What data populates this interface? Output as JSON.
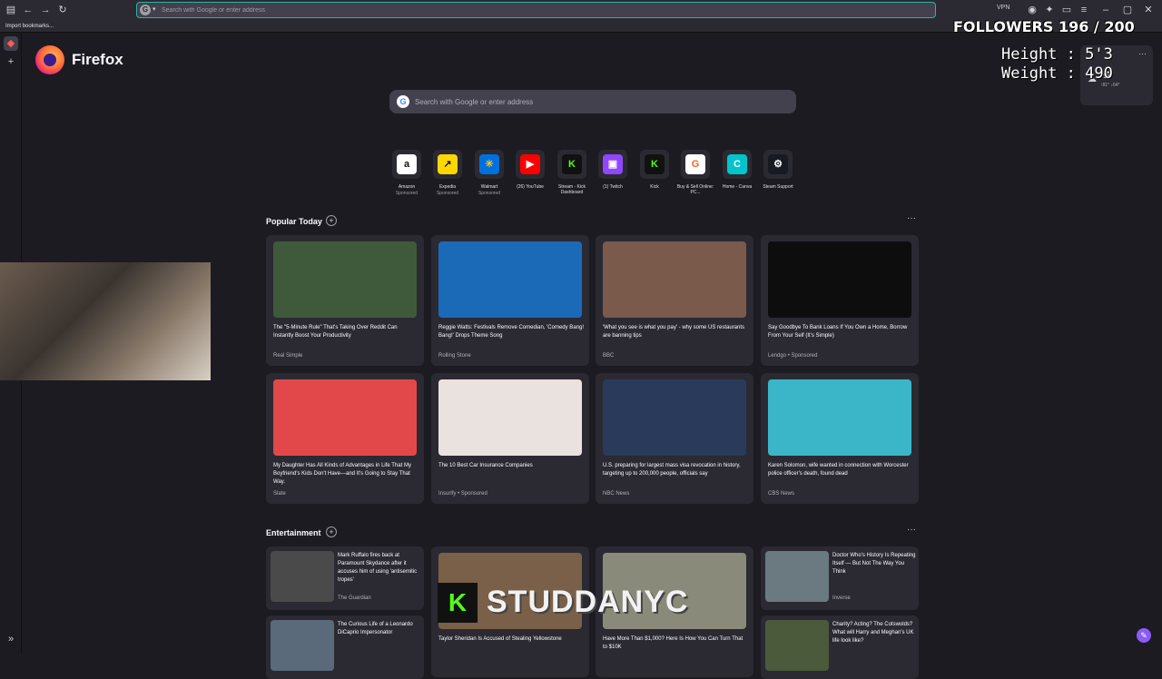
{
  "browser": {
    "url_placeholder": "Search with Google or enter address",
    "vpn_label": "VPN",
    "bookmark_item": "Import bookmarks..."
  },
  "brand": {
    "name": "Firefox"
  },
  "search": {
    "placeholder": "Search with Google or enter address"
  },
  "shortcuts": [
    {
      "label": "Amazon",
      "sponsored": "Sponsored",
      "glyph": "a",
      "bg": "#ffffff",
      "fg": "#111111"
    },
    {
      "label": "Expedia",
      "sponsored": "Sponsored",
      "glyph": "↗",
      "bg": "#ffd700",
      "fg": "#111111"
    },
    {
      "label": "Walmart",
      "sponsored": "Sponsored",
      "glyph": "✳",
      "bg": "#0071dc",
      "fg": "#ffc220"
    },
    {
      "label": "(26) YouTube",
      "sponsored": "",
      "glyph": "▶",
      "bg": "#ff0000",
      "fg": "#ffffff"
    },
    {
      "label": "Stream - Kick Dashboard",
      "sponsored": "",
      "glyph": "K",
      "bg": "#111111",
      "fg": "#53fc18"
    },
    {
      "label": "(1) Twitch",
      "sponsored": "",
      "glyph": "▣",
      "bg": "#9146ff",
      "fg": "#ffffff"
    },
    {
      "label": "Kick",
      "sponsored": "",
      "glyph": "K",
      "bg": "#111111",
      "fg": "#53fc18"
    },
    {
      "label": "Buy & Sell Online: PC...",
      "sponsored": "",
      "glyph": "G",
      "bg": "#ffffff",
      "fg": "#f26522"
    },
    {
      "label": "Home - Canva",
      "sponsored": "",
      "glyph": "C",
      "bg": "#00c4cc",
      "fg": "#ffffff"
    },
    {
      "label": "Steam Support",
      "sponsored": "",
      "glyph": "⚙",
      "bg": "#171a21",
      "fg": "#ffffff"
    }
  ],
  "popular": {
    "title": "Popular Today",
    "cards": [
      {
        "title": "The \"5-Minute Rule\" That's Taking Over Reddit Can Instantly Boost Your Productivity",
        "source": "Real Simple",
        "img": "#3f5a3a"
      },
      {
        "title": "Reggie Watts: Festivals Remove Comedian, 'Comedy Bang! Bang!' Drops Theme Song",
        "source": "Rolling Stone",
        "img": "#1a6ab8"
      },
      {
        "title": "'What you see is what you pay' - why some US restaurants are banning tips",
        "source": "BBC",
        "img": "#7a5a4a"
      },
      {
        "title": "Say Goodbye To Bank Loans If You Own a Home, Borrow From Your Self (It's Simple)",
        "source": "Lendgo • Sponsored",
        "img": "#0d0d0d"
      },
      {
        "title": "My Daughter Has All Kinds of Advantages in Life That My Boyfriend's Kids Don't Have—and It's Going to Stay That Way.",
        "source": "Slate",
        "img": "#e2484a"
      },
      {
        "title": "The 10 Best Car Insurance Companies",
        "source": "Insurify • Sponsored",
        "img": "#e9e2de"
      },
      {
        "title": "U.S. preparing for largest mass visa revocation in history, targeting up to 200,000 people, officials say",
        "source": "NBC News",
        "img": "#2a3a5a"
      },
      {
        "title": "Karen Solomon, wife wanted in connection with Worcester police officer's death, found dead",
        "source": "CBS News",
        "img": "#3ab6c8"
      }
    ]
  },
  "entertainment": {
    "title": "Entertainment",
    "cards": [
      {
        "title": "Mark Ruffalo fires back at Paramount Skydance after it accuses him of using 'antisemitic tropes'",
        "source": "The Guardian",
        "img": "#4a4a4a"
      },
      {
        "title": "Doctor Who's History Is Repeating Itself — But Not The Way You Think",
        "source": "Inverse",
        "img": "#6a7a80"
      },
      {
        "title": "The Curious Life of a Leonardo DiCaprio Impersonator",
        "source": "",
        "img": "#5a6a7a"
      },
      {
        "title": "Charity? Acting? The Cotswolds? What will Harry and Meghan's UK life look like?",
        "source": "",
        "img": "#4a5a3a"
      }
    ],
    "wide": [
      {
        "title": "Taylor Sheridan Is Accused of Stealing Yellowstone",
        "img": "#7a6048"
      },
      {
        "title": "Have More Than $1,000? Here Is How You Can Turn That to $10K",
        "img": "#8a8a7a"
      }
    ]
  },
  "overlay": {
    "followers": "FOLLOWERS 196 / 200",
    "height": "Height : 5'3",
    "weight": "Weight : 490",
    "watermark_letter": "K",
    "watermark_text": "STUDDANYC"
  },
  "weather": {
    "temp": "73°F",
    "range": "↑81° ↓64°"
  }
}
